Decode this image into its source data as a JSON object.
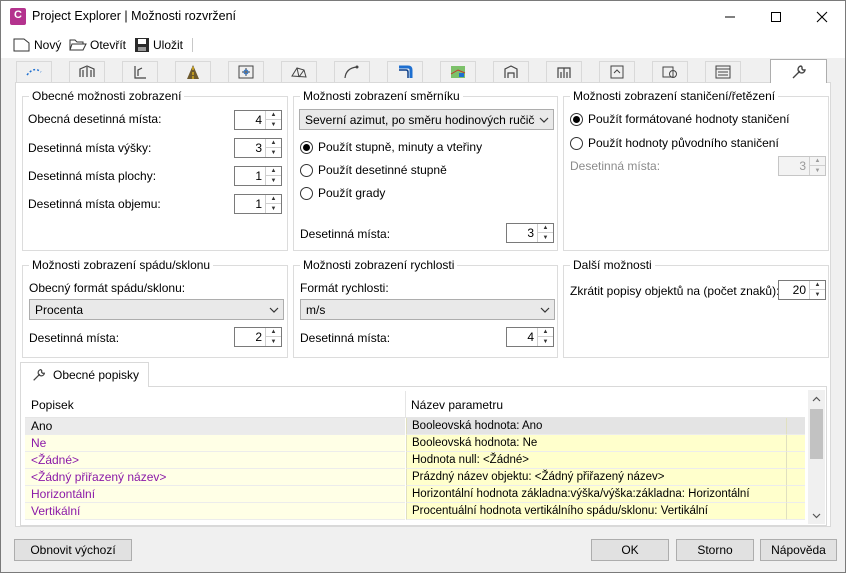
{
  "window": {
    "title": "Project Explorer | Možnosti rozvržení",
    "app_icon_letter": "C"
  },
  "toolbar": {
    "new_label": "Nový",
    "open_label": "Otevřít",
    "save_label": "Uložit"
  },
  "tabs": [
    {
      "icon": "alignment-dotted-icon"
    },
    {
      "icon": "bridge-icon"
    },
    {
      "icon": "profile-icon"
    },
    {
      "icon": "road-icon"
    },
    {
      "icon": "sample-line-icon"
    },
    {
      "icon": "surface-icon"
    },
    {
      "icon": "curve-icon"
    },
    {
      "icon": "pipe-network-icon"
    },
    {
      "icon": "parcel-icon"
    },
    {
      "icon": "assembly-icon"
    },
    {
      "icon": "subassembly-icon"
    },
    {
      "icon": "section-icon"
    },
    {
      "icon": "view-frame-icon"
    },
    {
      "icon": "table-icon"
    },
    {
      "icon": "wrench-icon",
      "active": true
    }
  ],
  "general": {
    "title": "Obecné možnosti zobrazení",
    "rows": [
      {
        "label": "Obecná desetinná místa:",
        "value": "4"
      },
      {
        "label": "Desetinná místa výšky:",
        "value": "3"
      },
      {
        "label": "Desetinná místa plochy:",
        "value": "1"
      },
      {
        "label": "Desetinná místa objemu:",
        "value": "1"
      }
    ]
  },
  "bearing": {
    "title": "Možnosti zobrazení směrníku",
    "combo": "Severní azimut, po směru hodinových ručiček",
    "radios": [
      {
        "label": "Použít stupně, minuty a vteřiny",
        "checked": true
      },
      {
        "label": "Použít desetinné stupně",
        "checked": false
      },
      {
        "label": "Použít grady",
        "checked": false
      }
    ],
    "decimal_label": "Desetinná místa:",
    "decimal_value": "3"
  },
  "station": {
    "title": "Možnosti zobrazení staničení/řetězení",
    "radios": [
      {
        "label": "Použít formátované hodnoty staničení",
        "checked": true
      },
      {
        "label": "Použít hodnoty původního staničení",
        "checked": false
      }
    ],
    "decimal_label": "Desetinná místa:",
    "decimal_value": "3"
  },
  "slope": {
    "title": "Možnosti zobrazení spádu/sklonu",
    "format_label": "Obecný formát spádu/sklonu:",
    "combo": "Procenta",
    "decimal_label": "Desetinná místa:",
    "decimal_value": "2"
  },
  "speed": {
    "title": "Možnosti zobrazení rychlosti",
    "format_label": "Formát rychlosti:",
    "combo": "m/s",
    "decimal_label": "Desetinná místa:",
    "decimal_value": "4"
  },
  "other": {
    "title": "Další možnosti",
    "truncate_label": "Zkrátit popisy objektů na (počet znaků):",
    "truncate_value": "20"
  },
  "labels_tab": {
    "title": "Obecné popisky"
  },
  "grid": {
    "col1": "Popisek",
    "col2": "Název parametru",
    "rows": [
      {
        "label": "Ano",
        "param": "Booleovská hodnota: Ano",
        "purple": false,
        "selected": true
      },
      {
        "label": "Ne",
        "param": "Booleovská hodnota: Ne",
        "purple": true,
        "selected": false
      },
      {
        "label": "<Žádné>",
        "param": "Hodnota null: <Žádné>",
        "purple": true,
        "selected": false
      },
      {
        "label": "<Žádný přiřazený název>",
        "param": "Prázdný název objektu: <Žádný přiřazený název>",
        "purple": true,
        "selected": false
      },
      {
        "label": "Horizontální",
        "param": "Horizontální hodnota základna:výška/výška:základna: Horizontální",
        "purple": true,
        "selected": false
      },
      {
        "label": "Vertikální",
        "param": "Procentuální hodnota vertikálního spádu/sklonu: Vertikální",
        "purple": true,
        "selected": false
      }
    ]
  },
  "buttons": {
    "reset": "Obnovit výchozí",
    "ok": "OK",
    "cancel": "Storno",
    "help": "Nápověda"
  }
}
